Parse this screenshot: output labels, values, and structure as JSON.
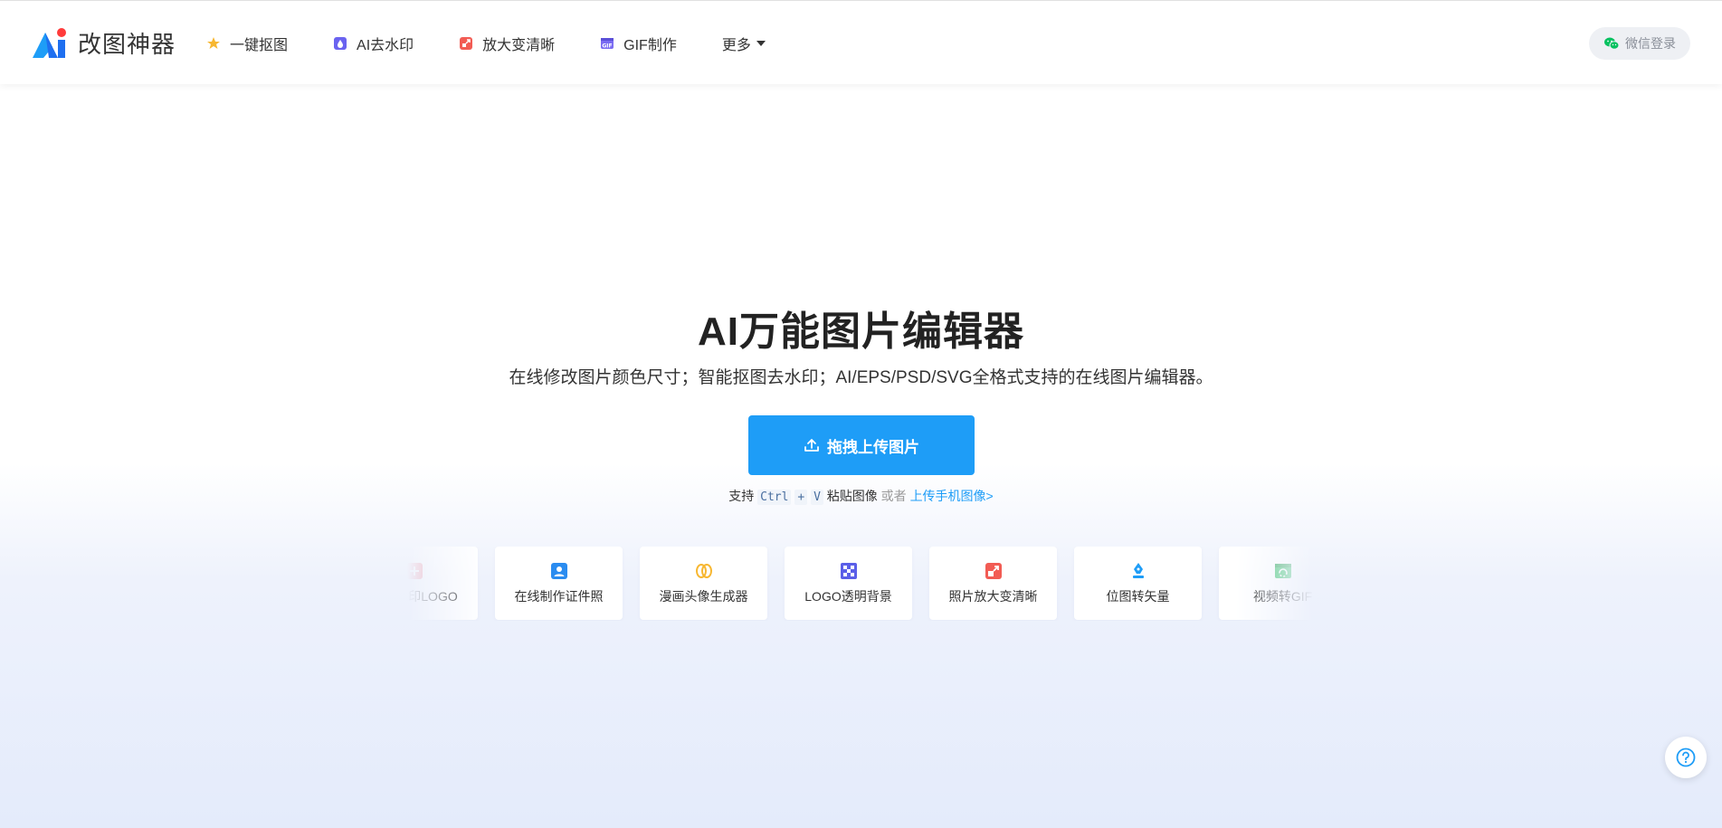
{
  "app": {
    "name": "改图神器"
  },
  "nav": {
    "items": [
      {
        "label": "一键抠图",
        "icon": "cutout-icon"
      },
      {
        "label": "AI去水印",
        "icon": "watermark-remove-icon"
      },
      {
        "label": "放大变清晰",
        "icon": "enlarge-icon"
      },
      {
        "label": "GIF制作",
        "icon": "gif-icon"
      }
    ],
    "more_label": "更多"
  },
  "login": {
    "label": "微信登录",
    "icon": "wechat-icon"
  },
  "hero": {
    "title": "AI万能图片编辑器",
    "subtitle": "在线修改图片颜色尺寸；智能抠图去水印；AI/EPS/PSD/SVG全格式支持的在线图片编辑器。",
    "upload_label": "拖拽上传图片"
  },
  "tip": {
    "prefix": "支持",
    "key1": "Ctrl",
    "plus": "+",
    "key2": "V",
    "paste": "粘贴图像",
    "or": "或者",
    "mobile_link": "上传手机图像>"
  },
  "tools": [
    {
      "label": "添加水印LOGO",
      "icon": "add-watermark-icon",
      "color": "#f26b7a"
    },
    {
      "label": "在线制作证件照",
      "icon": "id-photo-icon",
      "color": "#2a8cf0"
    },
    {
      "label": "漫画头像生成器",
      "icon": "cartoon-avatar-icon",
      "color": "#f7b731"
    },
    {
      "label": "LOGO透明背景",
      "icon": "transparent-bg-icon",
      "color": "#5b5fe8"
    },
    {
      "label": "照片放大变清晰",
      "icon": "photo-enlarge-icon",
      "color": "#f25c54"
    },
    {
      "label": "位图转矢量",
      "icon": "vector-pen-icon",
      "color": "#1e9df7"
    },
    {
      "label": "视频转GIF",
      "icon": "video-gif-icon",
      "color": "#3cc46e"
    }
  ],
  "colors": {
    "primary": "#1e9df7",
    "text": "#333333",
    "wechat": "#07c160"
  }
}
